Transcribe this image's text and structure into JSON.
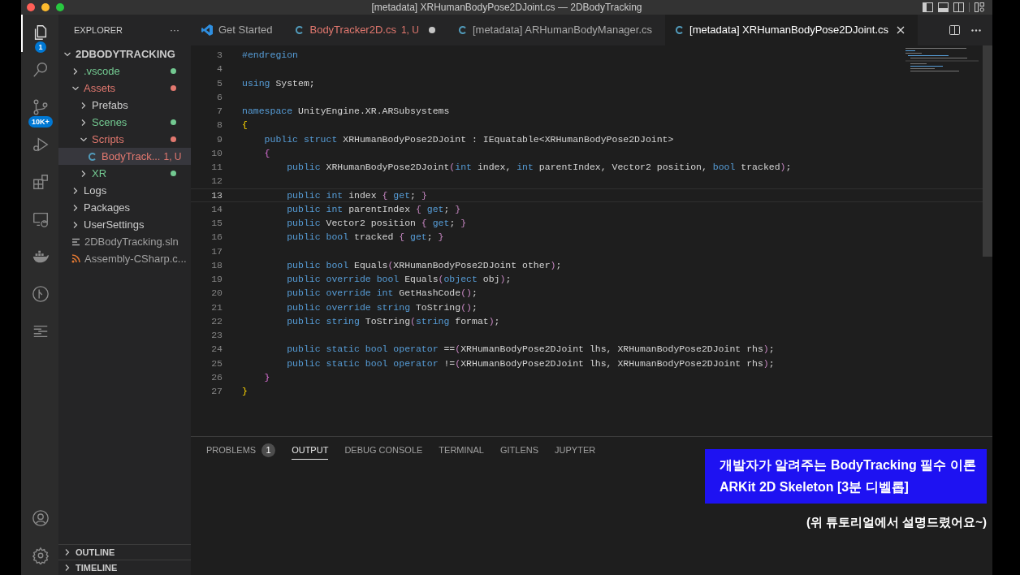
{
  "window": {
    "title": "[metadata] XRHumanBodyPose2DJoint.cs — 2DBodyTracking"
  },
  "activity_bar": [
    {
      "kind": "files",
      "selected": true,
      "badge": "1"
    },
    {
      "kind": "search",
      "selected": false
    },
    {
      "kind": "source-control",
      "selected": false,
      "badge": "10K+"
    },
    {
      "kind": "run",
      "selected": false
    },
    {
      "kind": "extensions",
      "selected": false
    },
    {
      "kind": "remote",
      "selected": false
    },
    {
      "kind": "docker",
      "selected": false
    },
    {
      "kind": "gitlens",
      "selected": false
    },
    {
      "kind": "outline",
      "selected": false
    }
  ],
  "activity_bar_bottom": [
    {
      "kind": "account"
    },
    {
      "kind": "settings"
    }
  ],
  "sidebar": {
    "title": "EXPLORER",
    "more": "···",
    "tree": [
      {
        "label": "2DBODYTRACKING",
        "kind": "root",
        "expanded": true,
        "children": [
          {
            "label": ".vscode",
            "kind": "folder",
            "expanded": false,
            "color": "#73c991"
          },
          {
            "label": "Assets",
            "kind": "folder",
            "expanded": true,
            "color": "#e2786f",
            "children": [
              {
                "label": "Prefabs",
                "kind": "folder",
                "expanded": false
              },
              {
                "label": "Scenes",
                "kind": "folder",
                "expanded": false,
                "color": "#73c991"
              },
              {
                "label": "Scripts",
                "kind": "folder",
                "expanded": true,
                "color": "#e2786f",
                "children": [
                  {
                    "label": "BodyTrack...",
                    "kind": "csharp",
                    "color": "#e2786f",
                    "badge": "1, U",
                    "selected": true
                  }
                ]
              },
              {
                "label": "XR",
                "kind": "folder",
                "expanded": false,
                "color": "#73c991"
              }
            ]
          },
          {
            "label": "Logs",
            "kind": "folder",
            "expanded": false
          },
          {
            "label": "Packages",
            "kind": "folder",
            "expanded": false
          },
          {
            "label": "UserSettings",
            "kind": "folder",
            "expanded": false
          },
          {
            "label": "2DBodyTracking.sln",
            "kind": "sln"
          },
          {
            "label": "Assembly-CSharp.c...",
            "kind": "csproj"
          }
        ]
      }
    ],
    "sections": [
      {
        "label": "OUTLINE",
        "expanded": false
      },
      {
        "label": "TIMELINE",
        "expanded": false
      }
    ]
  },
  "tabs": [
    {
      "label": "Get Started",
      "kind": "vscode",
      "selected": false
    },
    {
      "label": "BodyTracker2D.cs",
      "kind": "csharp",
      "selected": false,
      "color": "#e2786f",
      "badge": "1, U",
      "modified": true
    },
    {
      "label": "[metadata] ARHumanBodyManager.cs",
      "kind": "csharp",
      "selected": false
    },
    {
      "label": "[metadata] XRHumanBodyPose2DJoint.cs",
      "kind": "csharp",
      "selected": true
    }
  ],
  "editor": {
    "lines": [
      {
        "number": "3",
        "tokens": [
          {
            "kind": "keyword",
            "text": "#endregion"
          }
        ]
      },
      {
        "number": "4"
      },
      {
        "number": "5",
        "tokens": [
          {
            "kind": "keyword",
            "text": "using"
          },
          {
            "kind": "plain",
            "text": " System;"
          }
        ]
      },
      {
        "number": "6"
      },
      {
        "number": "7",
        "tokens": [
          {
            "kind": "keyword",
            "text": "namespace"
          },
          {
            "kind": "plain",
            "text": " UnityEngine.XR.ARSubsystems"
          }
        ]
      },
      {
        "number": "8",
        "tokens": [
          {
            "kind": "brace1",
            "text": "{"
          }
        ]
      },
      {
        "number": "9",
        "tokens": [
          {
            "kind": "keyword",
            "text": "    public struct"
          },
          {
            "kind": "plain",
            "text": " XRHumanBodyPose2DJoint : IEquatable<XRHumanBodyPose2DJoint>"
          }
        ]
      },
      {
        "number": "10",
        "tokens": [
          {
            "kind": "brace2",
            "text": "    {"
          }
        ]
      },
      {
        "number": "11",
        "tokens": [
          {
            "kind": "keyword",
            "text": "        public"
          },
          {
            "kind": "plain",
            "text": " XRHumanBodyPose2DJoint"
          },
          {
            "kind": "brace3",
            "text": "("
          },
          {
            "kind": "keyword",
            "text": "int"
          },
          {
            "kind": "plain",
            "text": " index, "
          },
          {
            "kind": "keyword",
            "text": "int"
          },
          {
            "kind": "plain",
            "text": " parentIndex, Vector2 position, "
          },
          {
            "kind": "keyword",
            "text": "bool"
          },
          {
            "kind": "plain",
            "text": " tracked"
          },
          {
            "kind": "brace3",
            "text": ")"
          },
          {
            "kind": "plain",
            "text": ";"
          }
        ]
      },
      {
        "number": "12"
      },
      {
        "number": "13",
        "selected": true,
        "tokens": [
          {
            "kind": "keyword",
            "text": "        public int"
          },
          {
            "kind": "plain",
            "text": " index "
          },
          {
            "kind": "brace3",
            "text": "{"
          },
          {
            "kind": "keyword",
            "text": " get"
          },
          {
            "kind": "plain",
            "text": "; "
          },
          {
            "kind": "brace3",
            "text": "}"
          }
        ]
      },
      {
        "number": "14",
        "selected": false,
        "tokens": [
          {
            "kind": "keyword",
            "text": "        public int"
          },
          {
            "kind": "plain",
            "text": " parentIndex "
          },
          {
            "kind": "brace3",
            "text": "{"
          },
          {
            "kind": "keyword",
            "text": " get"
          },
          {
            "kind": "plain",
            "text": "; "
          },
          {
            "kind": "brace3",
            "text": "}"
          }
        ]
      },
      {
        "number": "15",
        "tokens": [
          {
            "kind": "keyword",
            "text": "        public"
          },
          {
            "kind": "plain",
            "text": " Vector2 position "
          },
          {
            "kind": "brace3",
            "text": "{"
          },
          {
            "kind": "keyword",
            "text": " get"
          },
          {
            "kind": "plain",
            "text": "; "
          },
          {
            "kind": "brace3",
            "text": "}"
          }
        ]
      },
      {
        "number": "16",
        "tokens": [
          {
            "kind": "keyword",
            "text": "        public bool"
          },
          {
            "kind": "plain",
            "text": " tracked "
          },
          {
            "kind": "brace3",
            "text": "{"
          },
          {
            "kind": "keyword",
            "text": " get"
          },
          {
            "kind": "plain",
            "text": "; "
          },
          {
            "kind": "brace3",
            "text": "}"
          }
        ]
      },
      {
        "number": "17"
      },
      {
        "number": "18",
        "tokens": [
          {
            "kind": "keyword",
            "text": "        public bool"
          },
          {
            "kind": "plain",
            "text": " Equals"
          },
          {
            "kind": "brace3",
            "text": "("
          },
          {
            "kind": "plain",
            "text": "XRHumanBodyPose2DJoint other"
          },
          {
            "kind": "brace3",
            "text": ")"
          },
          {
            "kind": "plain",
            "text": ";"
          }
        ]
      },
      {
        "number": "19",
        "tokens": [
          {
            "kind": "keyword",
            "text": "        public override bool"
          },
          {
            "kind": "plain",
            "text": " Equals"
          },
          {
            "kind": "brace3",
            "text": "("
          },
          {
            "kind": "keyword",
            "text": "object"
          },
          {
            "kind": "plain",
            "text": " obj"
          },
          {
            "kind": "brace3",
            "text": ")"
          },
          {
            "kind": "plain",
            "text": ";"
          }
        ]
      },
      {
        "number": "20",
        "tokens": [
          {
            "kind": "keyword",
            "text": "        public override int"
          },
          {
            "kind": "plain",
            "text": " GetHashCode"
          },
          {
            "kind": "brace3",
            "text": "()"
          },
          {
            "kind": "plain",
            "text": ";"
          }
        ]
      },
      {
        "number": "21",
        "tokens": [
          {
            "kind": "keyword",
            "text": "        public override string"
          },
          {
            "kind": "plain",
            "text": " ToString"
          },
          {
            "kind": "brace3",
            "text": "()"
          },
          {
            "kind": "plain",
            "text": ";"
          }
        ]
      },
      {
        "number": "22",
        "tokens": [
          {
            "kind": "keyword",
            "text": "        public string"
          },
          {
            "kind": "plain",
            "text": " ToString"
          },
          {
            "kind": "brace3",
            "text": "("
          },
          {
            "kind": "keyword",
            "text": "string"
          },
          {
            "kind": "plain",
            "text": " format"
          },
          {
            "kind": "brace3",
            "text": ")"
          },
          {
            "kind": "plain",
            "text": ";"
          }
        ]
      },
      {
        "number": "23"
      },
      {
        "number": "24",
        "tokens": [
          {
            "kind": "keyword",
            "text": "        public static bool operator"
          },
          {
            "kind": "plain",
            "text": " =="
          },
          {
            "kind": "brace3",
            "text": "("
          },
          {
            "kind": "plain",
            "text": "XRHumanBodyPose2DJoint lhs, XRHumanBodyPose2DJoint rhs"
          },
          {
            "kind": "brace3",
            "text": ")"
          },
          {
            "kind": "plain",
            "text": ";"
          }
        ]
      },
      {
        "number": "25",
        "tokens": [
          {
            "kind": "keyword",
            "text": "        public static bool operator"
          },
          {
            "kind": "plain",
            "text": " !="
          },
          {
            "kind": "brace3",
            "text": "("
          },
          {
            "kind": "plain",
            "text": "XRHumanBodyPose2DJoint lhs, XRHumanBodyPose2DJoint rhs"
          },
          {
            "kind": "brace3",
            "text": ")"
          },
          {
            "kind": "plain",
            "text": ";"
          }
        ]
      },
      {
        "number": "26",
        "tokens": [
          {
            "kind": "brace2",
            "text": "    }"
          }
        ]
      },
      {
        "number": "27",
        "tokens": [
          {
            "kind": "brace1",
            "text": "}"
          }
        ]
      }
    ]
  },
  "panel": {
    "tabs": [
      {
        "label": "PROBLEMS",
        "selected": false,
        "badge": "1"
      },
      {
        "label": "OUTPUT",
        "selected": true
      },
      {
        "label": "DEBUG CONSOLE",
        "selected": false
      },
      {
        "label": "TERMINAL",
        "selected": false
      },
      {
        "label": "GITLENS",
        "selected": false
      },
      {
        "label": "JUPYTER",
        "selected": false
      }
    ]
  },
  "caption": {
    "lines": [
      "개발자가 알려주는 BodyTracking 필수 이론",
      "ARKit 2D Skeleton [3분 디벨롭]"
    ],
    "note": "(위 튜토리얼에서 설명드렸어요~)"
  }
}
